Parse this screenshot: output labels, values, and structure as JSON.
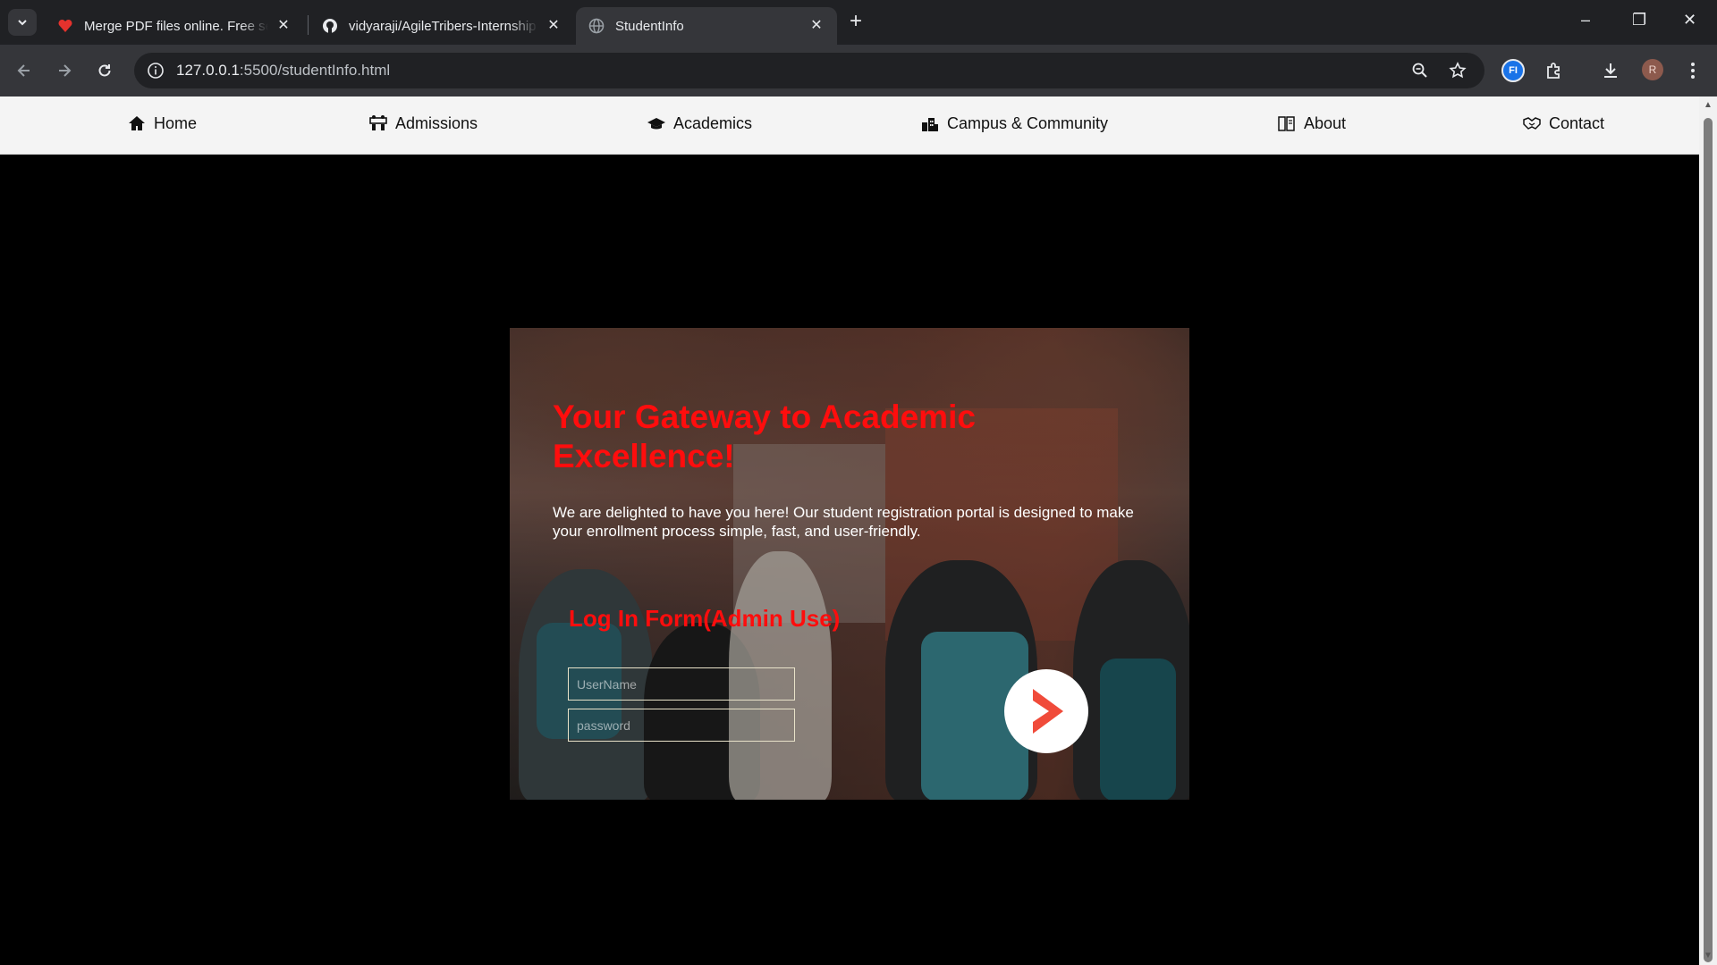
{
  "browser": {
    "tabs": [
      {
        "title": "Merge PDF files online. Free ser",
        "active": false
      },
      {
        "title": "vidyaraji/AgileTribers-Internship",
        "active": false
      },
      {
        "title": "StudentInfo",
        "active": true
      }
    ],
    "url_host": "127.0.0.1",
    "url_path": ":5500/studentInfo.html",
    "profile_initial": "R",
    "extension_label": "FI"
  },
  "nav": {
    "items": [
      {
        "label": "Home",
        "icon": "home-icon"
      },
      {
        "label": "Admissions",
        "icon": "admissions-icon"
      },
      {
        "label": "Academics",
        "icon": "graduation-cap-icon"
      },
      {
        "label": "Campus & Community",
        "icon": "campus-icon"
      },
      {
        "label": "About",
        "icon": "book-icon"
      },
      {
        "label": "Contact",
        "icon": "handshake-icon"
      }
    ]
  },
  "hero": {
    "title": "Your Gateway to Academic Excellence!",
    "text": "We are delighted to have you here! Our student registration portal is designed to make your enrollment process simple, fast, and user-friendly.",
    "form_title": "Log In Form(Admin Use)",
    "username_placeholder": "UserName",
    "password_placeholder": "password"
  },
  "colors": {
    "accent_red": "#ff0d0d",
    "arrow_red": "#f04b3a"
  }
}
